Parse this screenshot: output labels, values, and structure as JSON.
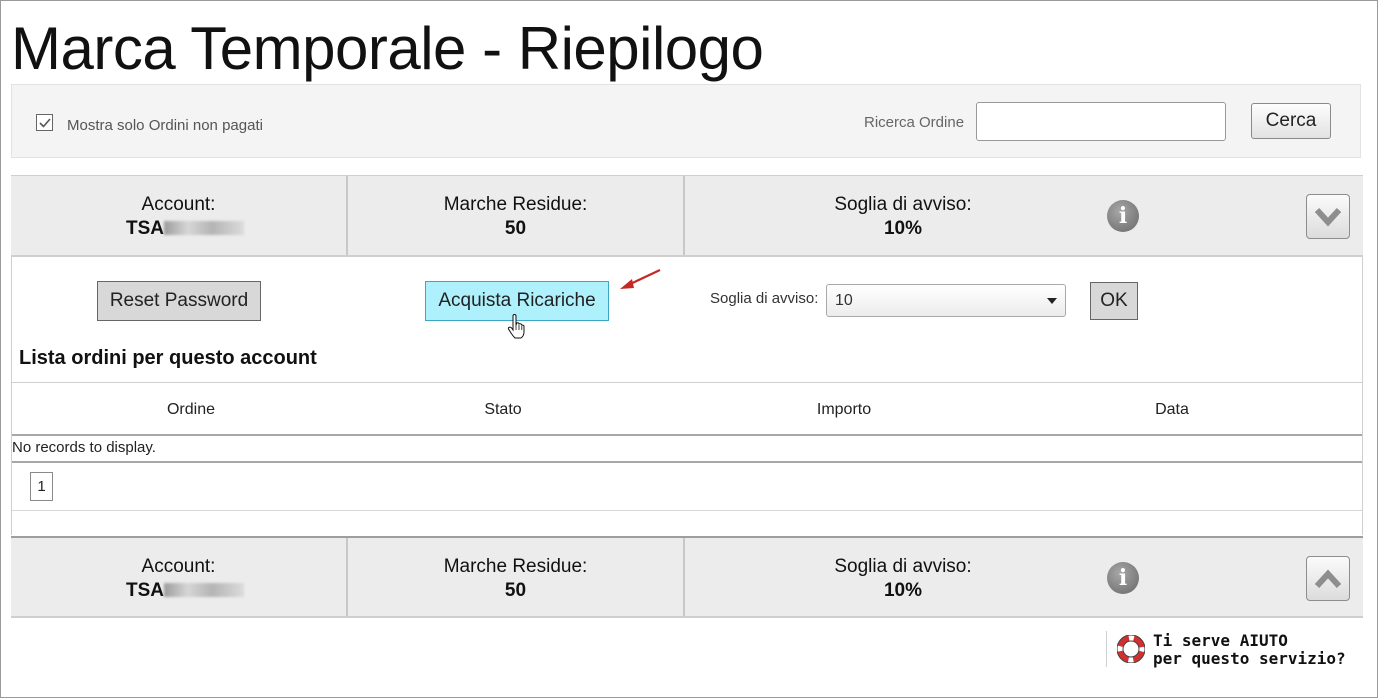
{
  "page": {
    "title": "Marca Temporale - Riepilogo"
  },
  "filters": {
    "only_unpaid_label": "Mostra solo Ordini non pagati",
    "only_unpaid_checked": true,
    "search_label": "Ricerca Ordine",
    "search_value": "",
    "search_button": "Cerca"
  },
  "account_summary": {
    "account_label": "Account:",
    "account_value": "TSA",
    "remaining_label": "Marche Residue:",
    "remaining_value": "50",
    "threshold_label": "Soglia di avviso:",
    "threshold_value": "10%",
    "info_icon": "info-icon",
    "expand_icon": "chevron-down-icon",
    "collapse_icon": "chevron-up-icon"
  },
  "actions": {
    "reset_password": "Reset Password",
    "buy_recharges": "Acquista Ricariche",
    "threshold_select_label": "Soglia di avviso:",
    "threshold_select_value": "10",
    "ok": "OK"
  },
  "orders": {
    "title": "Lista ordini per questo account",
    "columns": [
      "Ordine",
      "Stato",
      "Importo",
      "Data"
    ],
    "empty_message": "No records to display.",
    "pages": [
      "1"
    ]
  },
  "help": {
    "line1": "Ti serve AIUTO",
    "line2": "per questo servizio?",
    "icon": "lifebuoy-icon"
  }
}
